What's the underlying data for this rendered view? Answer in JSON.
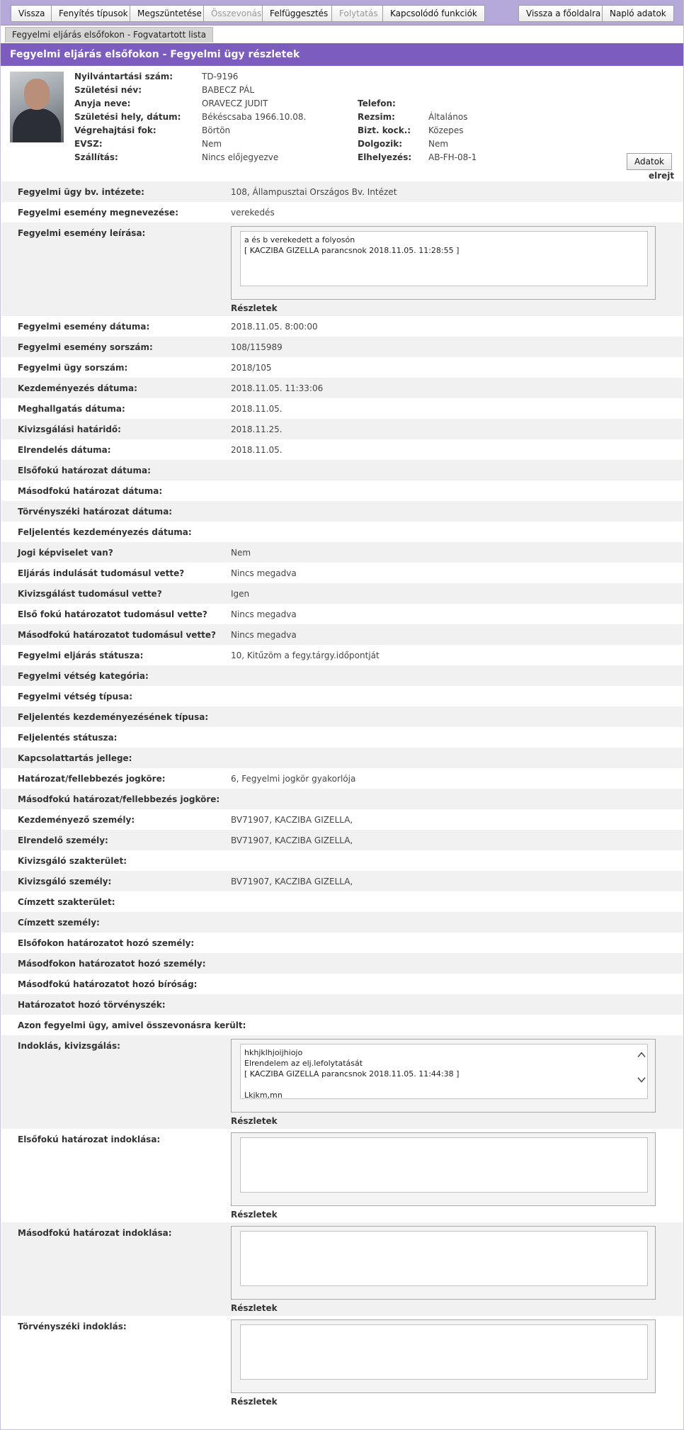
{
  "toolbar": {
    "buttons": [
      "Vissza",
      "Fenyítés típusok",
      "Megszüntetése",
      "Összevonás",
      "Felfüggesztés",
      "Folytatás",
      "Kapcsolódó funkciók"
    ],
    "right_buttons": [
      "Vissza a főoldalra",
      "Napló adatok"
    ]
  },
  "tab": "Fegyelmi eljárás elsőfokon - Fogvatartott lista",
  "title": "Fegyelmi eljárás elsőfokon - Fegyelmi ügy részletek",
  "person": {
    "left": [
      {
        "label": "Nyilvántartási szám:",
        "value": "TD-9196"
      },
      {
        "label": "Születési név:",
        "value": "BABECZ   PÁL"
      },
      {
        "label": "Anyja neve:",
        "value": "ORAVECZ JUDIT"
      },
      {
        "label": "Születési hely, dátum:",
        "value": "Békéscsaba    1966.10.08."
      },
      {
        "label": "Végrehajtási fok:",
        "value": "Börtön"
      },
      {
        "label": "EVSZ:",
        "value": "Nem"
      },
      {
        "label": "Szállítás:",
        "value": "Nincs előjegyezve"
      }
    ],
    "right": [
      {
        "label": "Telefon:",
        "value": ""
      },
      {
        "label": "Rezsim:",
        "value": "Általános"
      },
      {
        "label": "Bizt. kock.:",
        "value": "Közepes"
      },
      {
        "label": "Dolgozik:",
        "value": "Nem"
      },
      {
        "label": "Elhelyezés:",
        "value": "AB-FH-08-1"
      }
    ],
    "adatok_button": "Adatok",
    "hide_link": "elrejt"
  },
  "rows": [
    {
      "label": "Fegyelmi ügy bv. intézete:",
      "value": "108, Állampusztai Országos Bv. Intézet"
    },
    {
      "label": "Fegyelmi esemény megnevezése:",
      "value": "verekedés"
    },
    {
      "label": "Fegyelmi esemény leírása:",
      "text": [
        "a és b verekedett a folyosón",
        "[ KACZIBA GIZELLA parancsnok 2018.11.05. 11:28:55 ]"
      ],
      "link": "Részletek"
    },
    {
      "label": "Fegyelmi esemény dátuma:",
      "value": "2018.11.05. 8:00:00"
    },
    {
      "label": "Fegyelmi esemény sorszám:",
      "value": "108/115989"
    },
    {
      "label": "Fegyelmi ügy sorszám:",
      "value": "2018/105"
    },
    {
      "label": "Kezdeményezés dátuma:",
      "value": "2018.11.05. 11:33:06"
    },
    {
      "label": "Meghallgatás dátuma:",
      "value": "2018.11.05."
    },
    {
      "label": "Kivizsgálási határidő:",
      "value": "2018.11.25."
    },
    {
      "label": "Elrendelés dátuma:",
      "value": "2018.11.05."
    },
    {
      "label": "Elsőfokú határozat dátuma:",
      "value": ""
    },
    {
      "label": "Másodfokú határozat dátuma:",
      "value": ""
    },
    {
      "label": "Törvényszéki határozat dátuma:",
      "value": ""
    },
    {
      "label": "Feljelentés kezdeményezés dátuma:",
      "value": ""
    },
    {
      "label": "Jogi képviselet van?",
      "value": "Nem"
    },
    {
      "label": "Eljárás indulását tudomásul vette?",
      "value": "Nincs megadva"
    },
    {
      "label": "Kivizsgálást tudomásul vette?",
      "value": "Igen"
    },
    {
      "label": "Első fokú határozatot tudomásul vette?",
      "value": "Nincs megadva"
    },
    {
      "label": "Másodfokú határozatot tudomásul vette?",
      "value": "Nincs megadva"
    },
    {
      "label": "Fegyelmi eljárás státusza:",
      "value": "10, Kitűzöm a fegy.tárgy.időpontját"
    },
    {
      "label": "Fegyelmi vétség kategória:",
      "value": ""
    },
    {
      "label": "Fegyelmi vétség típusa:",
      "value": ""
    },
    {
      "label": "Feljelentés kezdeményezésének típusa:",
      "value": ""
    },
    {
      "label": "Feljelentés státusza:",
      "value": ""
    },
    {
      "label": "Kapcsolattartás jellege:",
      "value": ""
    },
    {
      "label": "Határozat/fellebbezés jogköre:",
      "value": "6, Fegyelmi jogkör gyakorlója"
    },
    {
      "label": "Másodfokú határozat/fellebbezés jogköre:",
      "value": ""
    },
    {
      "label": "Kezdeményező személy:",
      "value": "BV71907, KACZIBA GIZELLA,"
    },
    {
      "label": "Elrendelő személy:",
      "value": "BV71907, KACZIBA GIZELLA,"
    },
    {
      "label": "Kivizsgáló szakterület:",
      "value": ""
    },
    {
      "label": "Kivizsgáló személy:",
      "value": "BV71907, KACZIBA GIZELLA,"
    },
    {
      "label": "Címzett szakterület:",
      "value": ""
    },
    {
      "label": "Címzett személy:",
      "value": ""
    },
    {
      "label": "Elsőfokon határozatot hozó személy:",
      "value": ""
    },
    {
      "label": "Másodfokon határozatot hozó személy:",
      "value": ""
    },
    {
      "label": "Másodfokú határozatot hozó bíróság:",
      "value": ""
    },
    {
      "label": "Határozatot hozó törvényszék:",
      "value": ""
    },
    {
      "label": "Azon fegyelmi ügy, amivel összevonásra került:",
      "value": ""
    },
    {
      "label": "Indoklás, kivizsgálás:",
      "text": [
        "hkhjklhjoijhiojo",
        "Elrendelem az elj.lefolytatását",
        "[ KACZIBA GIZELLA parancsnok 2018.11.05. 11:44:38 ]",
        "",
        "Lkjkm,mn"
      ],
      "link": "Részletek"
    },
    {
      "label": "Elsőfokú határozat indoklása:",
      "text": [],
      "link": "Részletek"
    },
    {
      "label": "Másodfokú határozat indoklása:",
      "text": [],
      "link": "Részletek"
    },
    {
      "label": "Törvényszéki indoklás:",
      "text": [],
      "link": "Részletek"
    }
  ]
}
